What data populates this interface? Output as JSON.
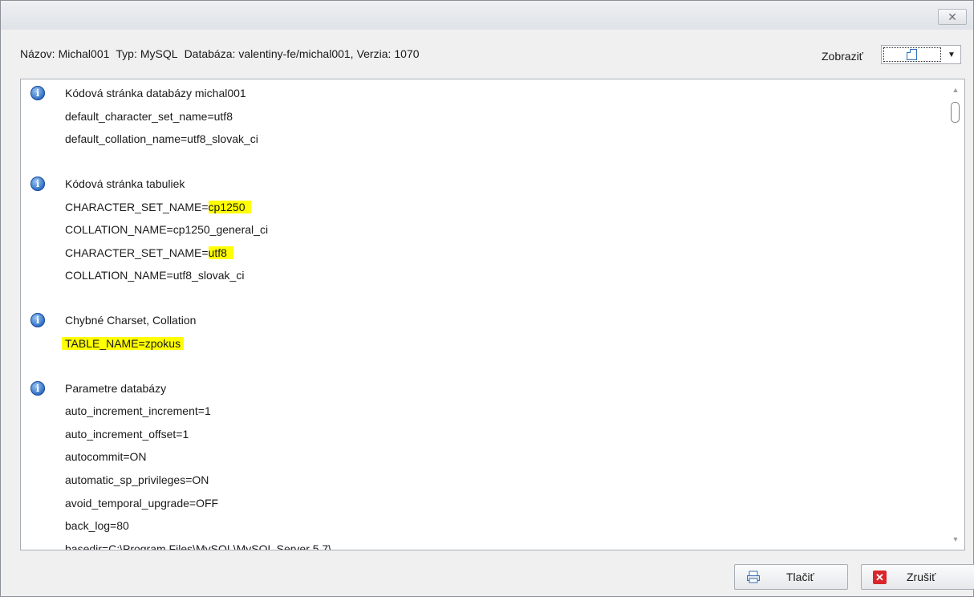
{
  "window": {
    "close_label": "✕"
  },
  "infobar": {
    "name_label": "Názov:",
    "name_value": "Michal001",
    "type_label": "Typ:",
    "type_value": "MySQL",
    "db_label": "Databáza:",
    "db_value": "valentiny-fe/michal001,",
    "version_label": "Verzia:",
    "version_value": "1070",
    "show_label": "Zobraziť"
  },
  "sections": [
    {
      "title": "Kódová stránka databázy michal001",
      "lines": [
        {
          "key": "default_character_set_name=",
          "value": "utf8",
          "highlight": "none"
        },
        {
          "key": "default_collation_name=",
          "value": "utf8_slovak_ci",
          "highlight": "none"
        }
      ]
    },
    {
      "title": "Kódová stránka tabuliek",
      "lines": [
        {
          "key": "CHARACTER_SET_NAME=",
          "value": "cp1250",
          "highlight": "value"
        },
        {
          "key": "COLLATION_NAME=",
          "value": "cp1250_general_ci",
          "highlight": "none"
        },
        {
          "key": "CHARACTER_SET_NAME=",
          "value": "utf8",
          "highlight": "value"
        },
        {
          "key": "COLLATION_NAME=",
          "value": "utf8_slovak_ci",
          "highlight": "none"
        }
      ]
    },
    {
      "title": "Chybné Charset, Collation",
      "lines": [
        {
          "key": "TABLE_NAME=",
          "value": "zpokus",
          "highlight": "full"
        }
      ]
    },
    {
      "title": "Parametre databázy",
      "lines": [
        {
          "key": "auto_increment_increment=",
          "value": "1",
          "highlight": "none"
        },
        {
          "key": "auto_increment_offset=",
          "value": "1",
          "highlight": "none"
        },
        {
          "key": "autocommit=",
          "value": "ON",
          "highlight": "none"
        },
        {
          "key": "automatic_sp_privileges=",
          "value": "ON",
          "highlight": "none"
        },
        {
          "key": "avoid_temporal_upgrade=",
          "value": "OFF",
          "highlight": "none"
        },
        {
          "key": "back_log=",
          "value": "80",
          "highlight": "none"
        },
        {
          "key": "basedir=",
          "value": "C:\\Program Files\\MySQL\\MySQL Server 5.7\\",
          "highlight": "none"
        }
      ]
    }
  ],
  "buttons": {
    "print_label": "Tlačiť",
    "cancel_label": "Zrušiť"
  },
  "colors": {
    "highlight": "#ffff00",
    "info_icon": "#2f6fc6",
    "cancel_icon": "#d9262b"
  },
  "icons": {
    "info": "info-icon",
    "print": "printer-icon",
    "cancel": "cancel-x-icon",
    "view_mode": "page-icon"
  }
}
